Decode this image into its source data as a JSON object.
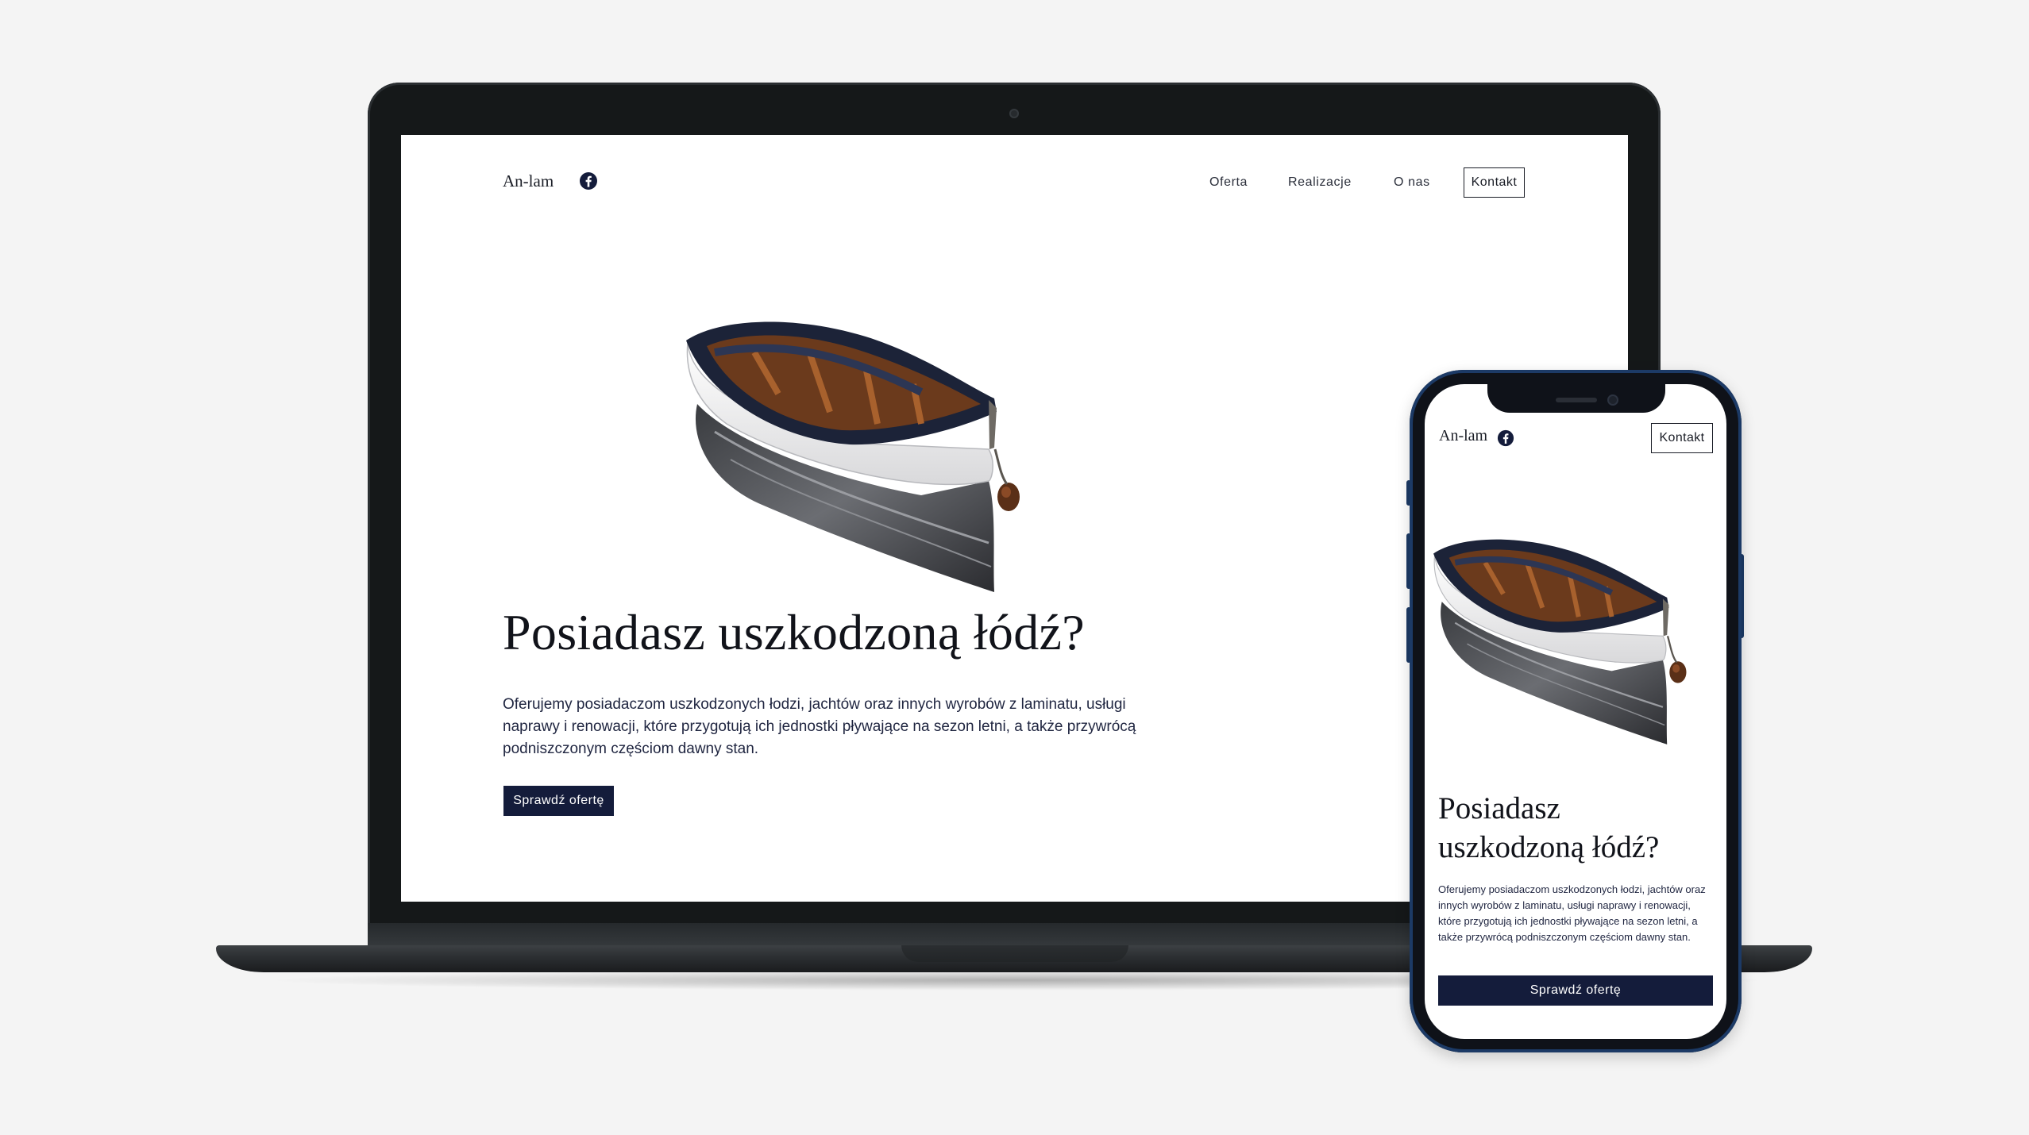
{
  "desktop": {
    "logo": "An-lam",
    "nav": [
      {
        "label": "Oferta"
      },
      {
        "label": "Realizacje"
      },
      {
        "label": "O nas"
      },
      {
        "label": "Kontakt"
      }
    ],
    "hero": {
      "title": "Posiadasz uszkodzoną łódź?",
      "description": "Oferujemy posiadaczom uszkodzonych łodzi, jachtów oraz innych wyrobów z laminatu, usługi naprawy i renowacji, które przygotują ich jednostki pływające na sezon letni, a także przywrócą podniszczonym częściom dawny stan.",
      "cta": "Sprawdź ofertę"
    }
  },
  "mobile": {
    "logo": "An-lam",
    "contact": "Kontakt",
    "hero": {
      "title": "Posiadasz uszkodzoną łódź?",
      "description": "Oferujemy posiadaczom uszkodzonych łodzi, jachtów oraz innych wyrobów z laminatu, usługi naprawy i renowacji, które przygotują ich jednostki pływające na sezon letni, a także przywrócą podniszczonym częściom dawny stan.",
      "cta": "Sprawdź ofertę"
    }
  },
  "icons": {
    "social": "facebook-icon",
    "hero_image": "boat-image"
  },
  "colors": {
    "background": "#f4f4f4",
    "brand_navy": "#141c3b",
    "text_dark": "#11131a",
    "device_frame": "#151819",
    "phone_frame_accent": "#1c3a66"
  }
}
